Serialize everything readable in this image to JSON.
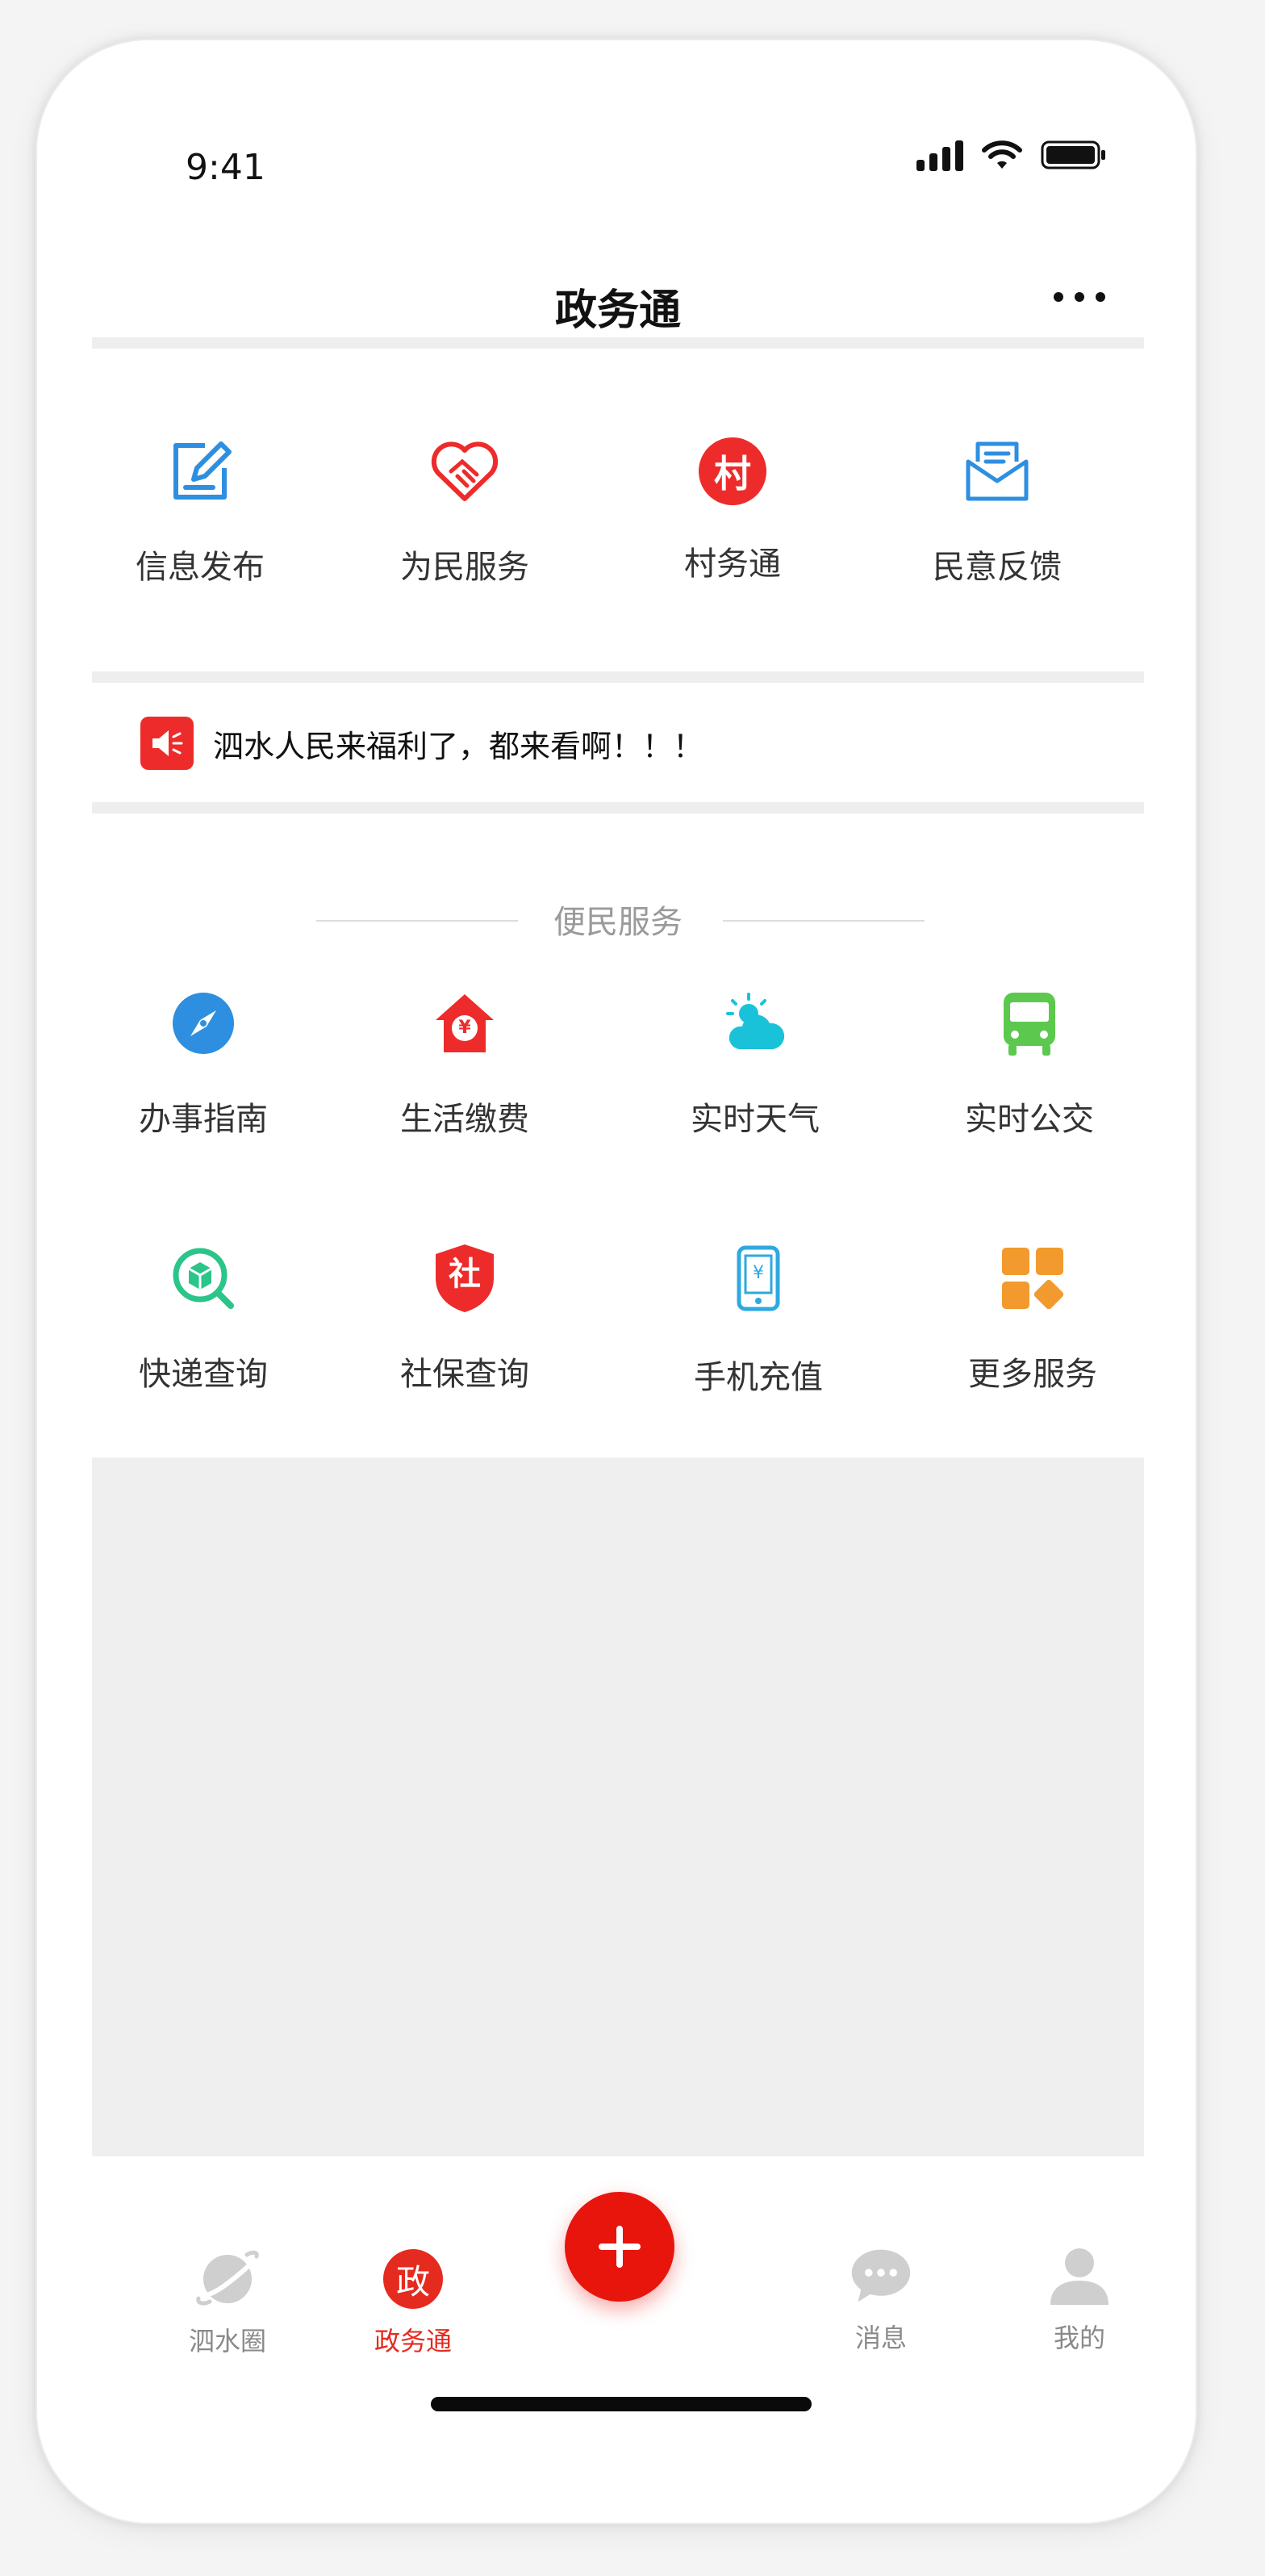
{
  "status_bar": {
    "time": "9:41"
  },
  "header": {
    "title": "政务通"
  },
  "top_grid": [
    {
      "label": "信息发布",
      "icon": "edit-document-icon",
      "color": "#2e8fe0"
    },
    {
      "label": "为民服务",
      "icon": "handshake-heart-icon",
      "color": "#ee2b2b"
    },
    {
      "label": "村务通",
      "icon": "village-affairs-icon",
      "color": "#ee2b2b",
      "glyph": "村"
    },
    {
      "label": "民意反馈",
      "icon": "feedback-mail-icon",
      "color": "#2e8fe0"
    }
  ],
  "notice": {
    "text": "泗水人民来福利了，都来看啊！！！"
  },
  "services": {
    "title": "便民服务",
    "items": [
      {
        "label": "办事指南",
        "icon": "compass-icon",
        "color": "#2e8fe0"
      },
      {
        "label": "生活缴费",
        "icon": "house-payment-icon",
        "color": "#ee2b2b",
        "glyph": "¥"
      },
      {
        "label": "实时天气",
        "icon": "weather-sun-cloud-icon",
        "color": "#19c2d8"
      },
      {
        "label": "实时公交",
        "icon": "bus-icon",
        "color": "#5cc94e"
      },
      {
        "label": "快递查询",
        "icon": "package-search-icon",
        "color": "#2bc58a"
      },
      {
        "label": "社保查询",
        "icon": "social-security-shield-icon",
        "color": "#ee2b2b",
        "glyph": "社"
      },
      {
        "label": "手机充值",
        "icon": "phone-recharge-icon",
        "color": "#2ea9e0",
        "glyph": "¥"
      },
      {
        "label": "更多服务",
        "icon": "more-services-grid-icon",
        "color": "#f29a2e"
      }
    ]
  },
  "tab_bar": {
    "items": [
      {
        "label": "泗水圈",
        "icon": "planet-icon",
        "active": false
      },
      {
        "label": "政务通",
        "icon": "government-icon",
        "active": true,
        "glyph": "政"
      },
      {
        "label": "消息",
        "icon": "chat-bubble-icon",
        "active": false
      },
      {
        "label": "我的",
        "icon": "user-profile-icon",
        "active": false
      }
    ],
    "fab_icon": "plus-icon"
  },
  "colors": {
    "accent": "#e8150d",
    "tab_inactive": "#8a8a8a",
    "divider": "#eeeeee"
  }
}
